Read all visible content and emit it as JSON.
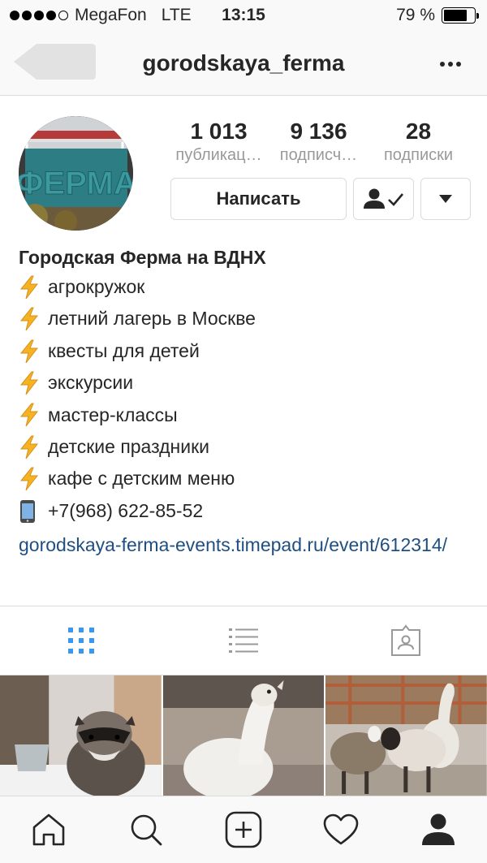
{
  "status_bar": {
    "carrier": "MegaFon",
    "network": "LTE",
    "time": "13:15",
    "battery_text": "79 %",
    "battery_level": 0.79
  },
  "nav": {
    "username": "gorodskaya_ferma",
    "back_icon": "back-arrow-icon",
    "more_icon": "more-options-icon"
  },
  "profile": {
    "avatar_text": "ФЕРМА",
    "stats": [
      {
        "value": "1 013",
        "label": "публикац…"
      },
      {
        "value": "9 136",
        "label": "подписч…"
      },
      {
        "value": "28",
        "label": "подписки"
      }
    ],
    "message_button": "Написать",
    "follow_icon": "following-check-icon",
    "dropdown_icon": "caret-down-icon"
  },
  "bio": {
    "name": "Городская Ферма на ВДНХ",
    "lines": [
      "агрокружок",
      "летний лагерь в Москве",
      "квесты для детей",
      "экскурсии",
      "мастер-классы",
      "детские праздники",
      "кафе с детским меню"
    ],
    "phone": "+7(968) 622-85-52",
    "link": "gorodskaya-ferma-events.timepad.ru/event/612314/"
  },
  "tabs": [
    {
      "icon": "grid-view-icon",
      "active": true
    },
    {
      "icon": "list-view-icon",
      "active": false
    },
    {
      "icon": "tagged-photos-icon",
      "active": false
    }
  ],
  "bottom_nav": [
    "home-icon",
    "search-icon",
    "add-post-icon",
    "activity-heart-icon",
    "profile-icon"
  ],
  "colors": {
    "accent_blue": "#3897f0",
    "link": "#1f4f82",
    "text": "#262626",
    "secondary": "#999999",
    "border": "#dbdbdb",
    "bar_bg": "#f9f9f9",
    "bolt": "#f5b323"
  }
}
